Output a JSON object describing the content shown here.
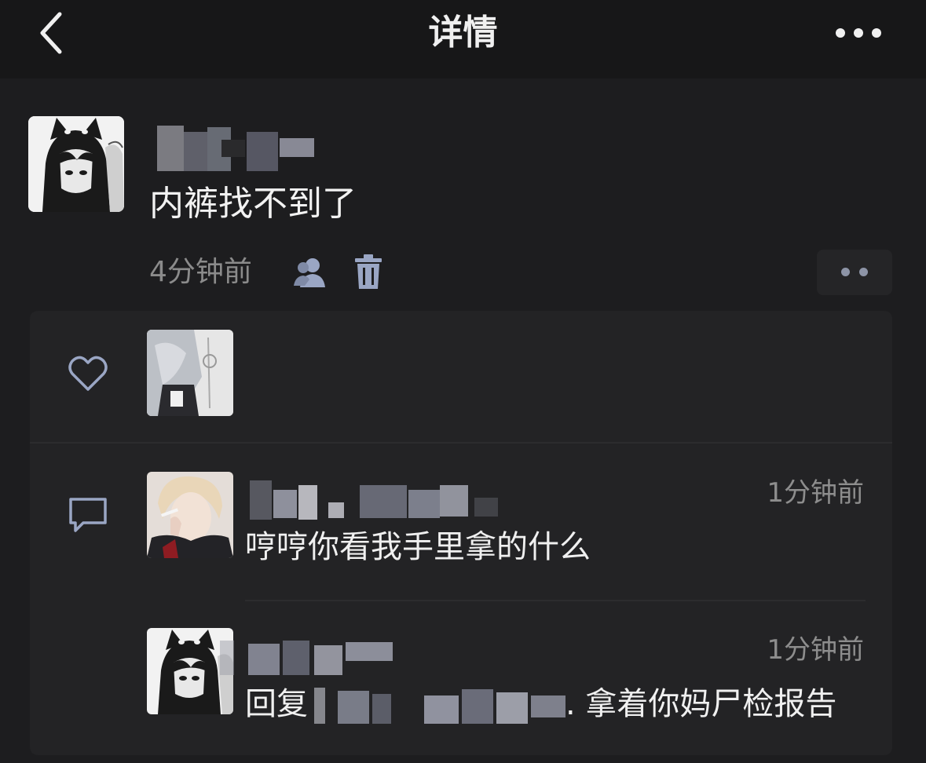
{
  "header": {
    "title": "详情",
    "back_icon": "back-chevron-icon",
    "more_icon": "more-dots-icon"
  },
  "post": {
    "text": "内裤找不到了",
    "time": "4分钟前",
    "visibility_icon": "friends-visible-icon",
    "delete_icon": "trash-icon",
    "action_icon": "two-dots-icon"
  },
  "likes": {
    "icon": "heart-icon",
    "count_avatars": 1
  },
  "comments": {
    "icon": "comment-bubble-icon",
    "items": [
      {
        "time": "1分钟前",
        "text": "哼哼你看我手里拿的什么"
      },
      {
        "time": "1分钟前",
        "reply_label": "回复",
        "text": ". 拿着你妈尸检报告"
      }
    ]
  },
  "colors": {
    "background": "#1d1d1f",
    "panel": "#232325",
    "text_primary": "#f0f0f0",
    "text_secondary": "#8b8b8b",
    "icon_accent": "#9aa6c4"
  }
}
